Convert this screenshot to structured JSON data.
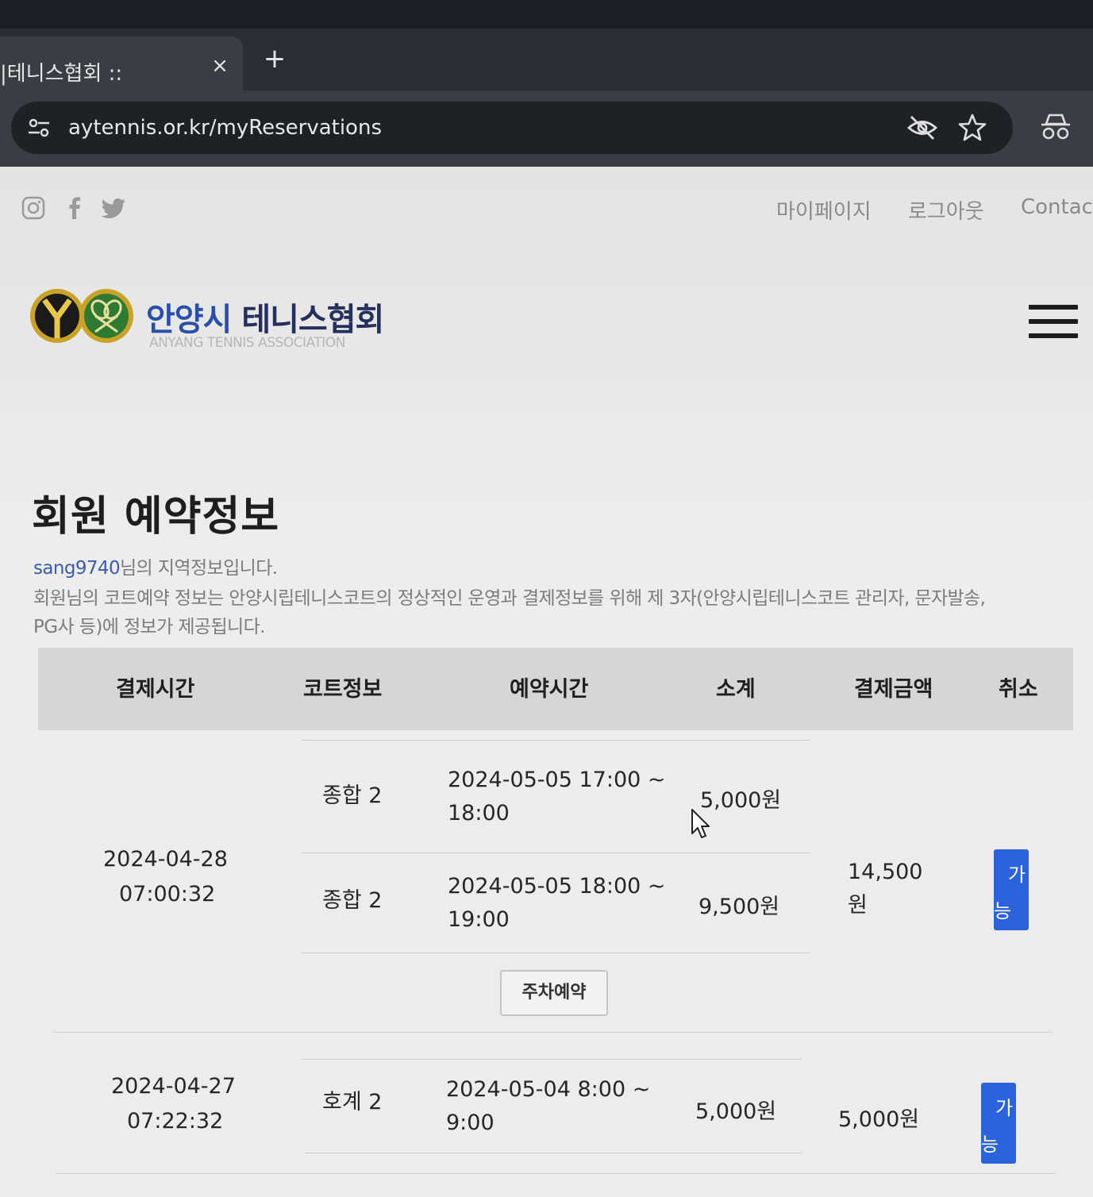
{
  "browser": {
    "tab_title": "|테니스협회 ::",
    "tab_close": "×",
    "new_tab": "+",
    "url": "aytennis.or.kr/myReservations"
  },
  "topnav": {
    "mypage": "마이페이지",
    "logout": "로그아웃",
    "contact": "Contact"
  },
  "logo": {
    "name_highlight": "안양시",
    "name_rest": " 테니스협회",
    "english": "ANYANG TENNIS ASSOCIATION"
  },
  "page": {
    "title": "회원 예약정보",
    "username": "sang9740",
    "intro_suffix": "님의 지역정보입니다.",
    "notice_line1": "회원님의 코트예약 정보는 안양시립테니스코트의 정상적인 운영과 결제정보를 위해 제 3자(안양시립테니스코트 관리자, 문자발송,",
    "notice_line2": "PG사 등)에 정보가 제공됩니다."
  },
  "table": {
    "headers": [
      "결제시간",
      "코트정보",
      "예약시간",
      "소계",
      "결제금액",
      "취소"
    ],
    "orders": [
      {
        "pay_date": "2024-04-28",
        "pay_time": "07:00:32",
        "items": [
          {
            "court": "종합 2",
            "time_line1": "2024-05-05 17:00 ~",
            "time_line2": "18:00",
            "subtotal": "5,000원"
          },
          {
            "court": "종합 2",
            "time_line1": "2024-05-05 18:00 ~",
            "time_line2": "19:00",
            "subtotal": "9,500원"
          }
        ],
        "total_line1": "14,500",
        "total_line2": "원",
        "cancel_line1": "가",
        "cancel_line2": "능",
        "parking_label": "주차예약"
      },
      {
        "pay_date": "2024-04-27",
        "pay_time": "07:22:32",
        "items": [
          {
            "court": "호계 2",
            "time_line1": "2024-05-04 8:00 ~",
            "time_line2": "9:00",
            "subtotal": "5,000원"
          }
        ],
        "total": "5,000원",
        "cancel_line1": "가",
        "cancel_line2": "능"
      }
    ]
  }
}
